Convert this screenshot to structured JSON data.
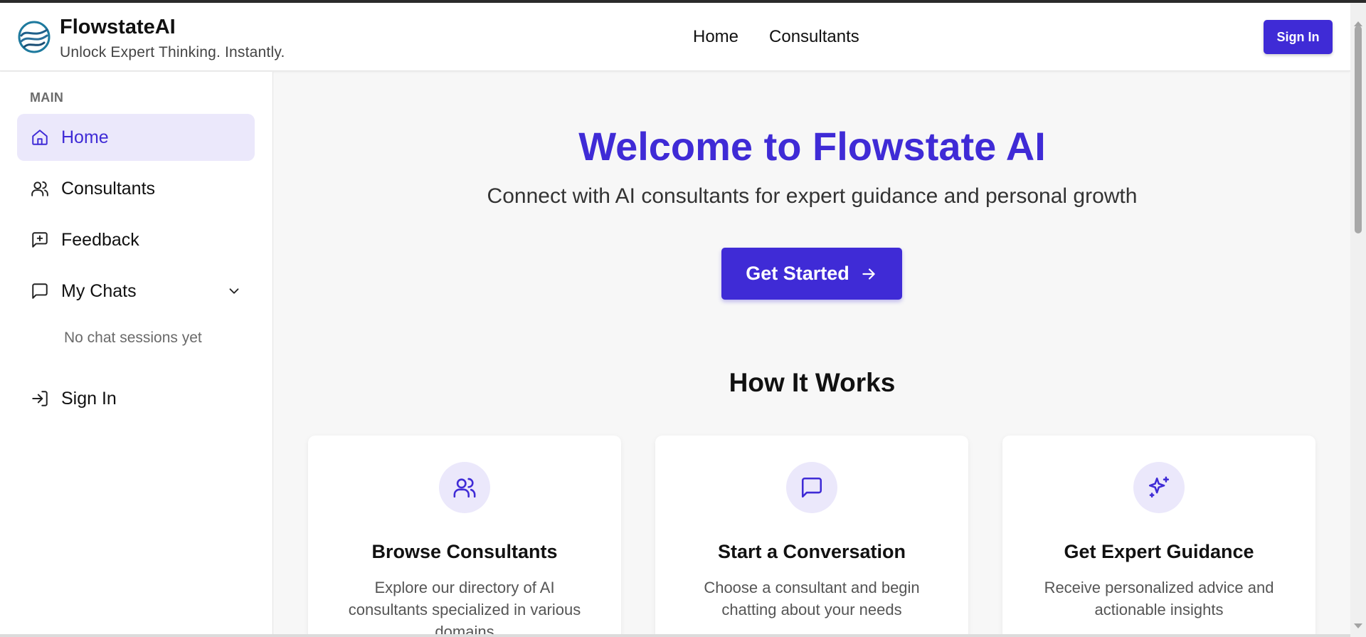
{
  "header": {
    "brand_title": "FlowstateAI",
    "brand_tagline": "Unlock Expert Thinking. Instantly.",
    "nav": [
      "Home",
      "Consultants"
    ],
    "sign_in": "Sign In"
  },
  "sidebar": {
    "section_label": "MAIN",
    "items": [
      {
        "label": "Home",
        "icon": "home-icon",
        "active": true
      },
      {
        "label": "Consultants",
        "icon": "users-icon"
      },
      {
        "label": "Feedback",
        "icon": "message-plus-icon"
      },
      {
        "label": "My Chats",
        "icon": "chat-icon"
      },
      {
        "label": "Sign In",
        "icon": "sign-in-icon"
      }
    ],
    "empty_chats": "No chat sessions yet"
  },
  "main": {
    "title": "Welcome to Flowstate AI",
    "subtitle": "Connect with AI consultants for expert guidance and personal growth",
    "cta": "Get Started",
    "how_title": "How It Works",
    "cards": [
      {
        "title": "Browse Consultants",
        "desc": "Explore our directory of AI consultants specialized in various domains",
        "icon": "users-icon"
      },
      {
        "title": "Start a Conversation",
        "desc": "Choose a consultant and begin chatting about your needs",
        "icon": "chat-icon"
      },
      {
        "title": "Get Expert Guidance",
        "desc": "Receive personalized advice and actionable insights",
        "icon": "sparkles-icon"
      }
    ]
  },
  "colors": {
    "accent": "#3f2bd6",
    "accent_light": "#ebe8fb",
    "background": "#f7f7f7"
  }
}
